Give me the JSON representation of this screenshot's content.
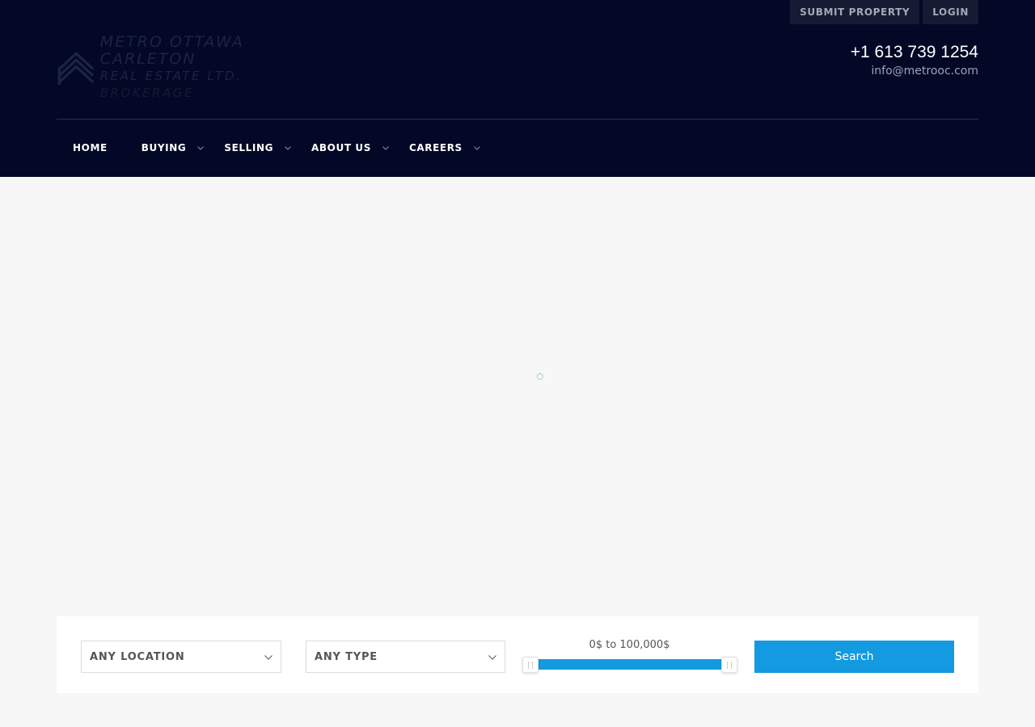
{
  "topbar": {
    "submit_property": "SUBMIT PROPERTY",
    "login": "LOGIN"
  },
  "logo": {
    "line1": "METRO OTTAWA CARLETON",
    "line2_main": "REAL ESTATE LTD.",
    "line2_sub": "BROKERAGE"
  },
  "contact": {
    "phone": "+1 613 739 1254",
    "email": "info@metrooc.com"
  },
  "nav": {
    "items": [
      {
        "label": "HOME",
        "has_dropdown": false
      },
      {
        "label": "BUYING",
        "has_dropdown": true
      },
      {
        "label": "SELLING",
        "has_dropdown": true
      },
      {
        "label": "ABOUT US",
        "has_dropdown": true
      },
      {
        "label": "CAREERS",
        "has_dropdown": true
      }
    ]
  },
  "search": {
    "location": "ANY LOCATION",
    "type": "ANY TYPE",
    "price_range": "0$ to 100,000$",
    "button": "Search"
  },
  "colors": {
    "header_bg": "#020826",
    "accent": "#139ae0",
    "page_bg": "#f7f7f7"
  },
  "icons": {
    "loading": "loading-spinner-icon",
    "dropdown": "chevron-down-icon"
  }
}
